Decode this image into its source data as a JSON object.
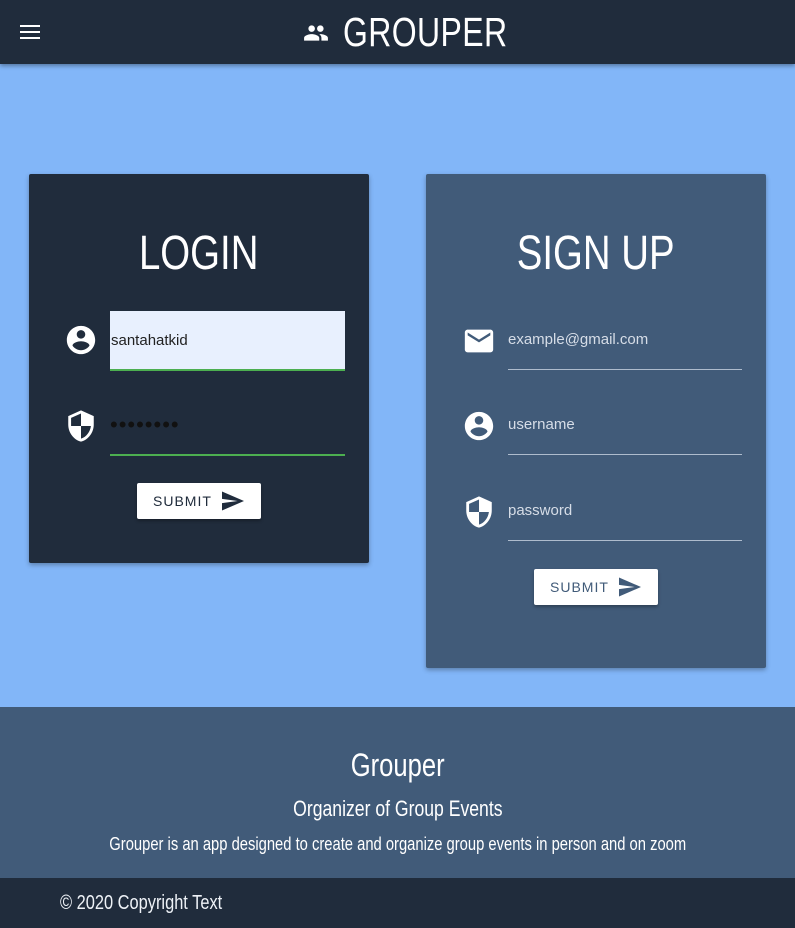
{
  "navbar": {
    "title": "GROUPER",
    "menu_icon": "menu-icon",
    "brand_icon": "people-icon"
  },
  "login": {
    "title": "LOGIN",
    "username_value": "santahatkid",
    "password_value": "••••••••",
    "user_icon": "account-circle-icon",
    "password_icon": "shield-icon",
    "submit_label": "SUBMIT",
    "submit_icon": "send-icon"
  },
  "signup": {
    "title": "SIGN UP",
    "email_placeholder": "example@gmail.com",
    "username_placeholder": "username",
    "password_placeholder": "password",
    "email_icon": "email-icon",
    "user_icon": "account-circle-icon",
    "password_icon": "shield-icon",
    "submit_label": "SUBMIT",
    "submit_icon": "send-icon"
  },
  "footer": {
    "title": "Grouper",
    "subtitle": "Organizer of Group Events",
    "description": "Grouper is an app designed to create and organize group events in person and on zoom",
    "copyright": "© 2020 Copyright Text"
  },
  "colors": {
    "page_background": "#82b6f8",
    "navbar": "#202c3c",
    "login_card": "#202c3c",
    "signup_card": "#415b79",
    "footer": "#415b79",
    "valid_underline": "#4caf50"
  }
}
